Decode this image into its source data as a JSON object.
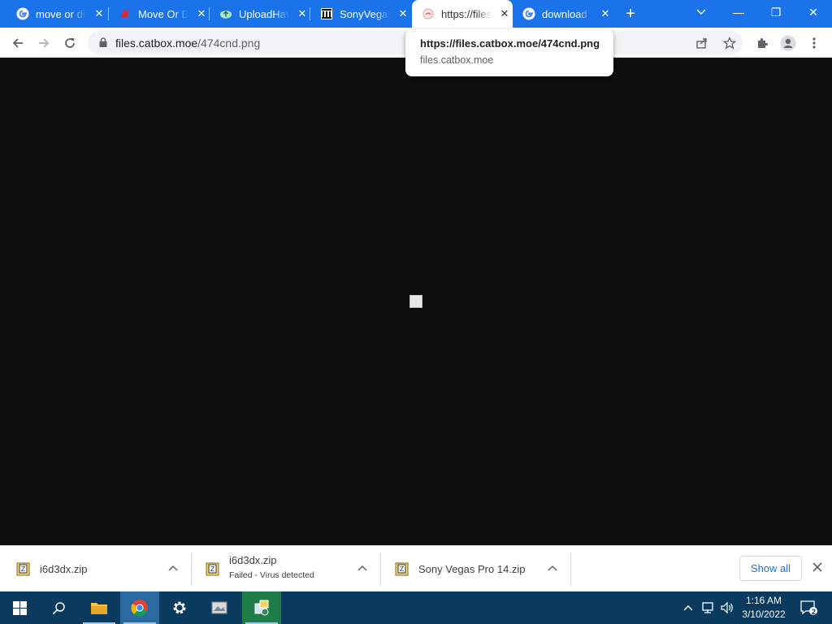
{
  "tabs": [
    {
      "title": "move or dir",
      "favicon": "google-icon"
    },
    {
      "title": "Move Or Die",
      "favicon": "moveordie-icon"
    },
    {
      "title": "UploadHaven",
      "favicon": "uploadhaven-icon"
    },
    {
      "title": "SonyVegas",
      "favicon": "museum-icon"
    },
    {
      "title": "https://files.catbox.moe",
      "favicon": "catbox-icon",
      "active": true
    },
    {
      "title": "download",
      "favicon": "google-icon"
    }
  ],
  "window": {
    "minimize": "—",
    "restore": "❐",
    "close": "✕"
  },
  "address": {
    "host": "files.catbox.moe",
    "path": "/474cnd.png"
  },
  "tooltip": {
    "url": "https://files.catbox.moe/474cnd.png",
    "host": "files.catbox.moe"
  },
  "downloads": [
    {
      "name": "i6d3dx.zip",
      "status": ""
    },
    {
      "name": "i6d3dx.zip",
      "status": "Failed - Virus detected"
    },
    {
      "name": "Sony Vegas Pro 14.zip",
      "status": ""
    }
  ],
  "shelf": {
    "show_all": "Show all"
  },
  "clock": {
    "time": "1:16 AM",
    "date": "3/10/2022"
  },
  "notifications": {
    "count": "2"
  },
  "colors": {
    "accent": "#1a73e8",
    "content_bg": "#0e0e0e",
    "taskbar": "#0a3a5e"
  }
}
